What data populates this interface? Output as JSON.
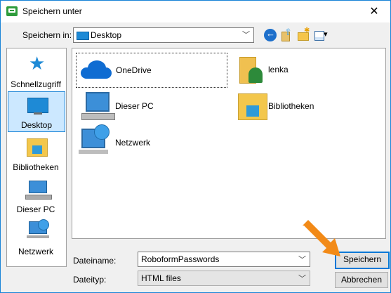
{
  "window": {
    "title": "Speichern unter",
    "close_glyph": "✕"
  },
  "toolbar": {
    "lookin_label": "Speichern in:",
    "lookin_value": "Desktop"
  },
  "places": [
    {
      "label": "Schnellzugriff",
      "icon": "star-icon",
      "selected": false
    },
    {
      "label": "Desktop",
      "icon": "desktop-icon",
      "selected": true
    },
    {
      "label": "Bibliotheken",
      "icon": "libraries-icon",
      "selected": false
    },
    {
      "label": "Dieser PC",
      "icon": "computer-icon",
      "selected": false
    },
    {
      "label": "Netzwerk",
      "icon": "network-icon",
      "selected": false
    }
  ],
  "items": [
    {
      "label": "OneDrive",
      "icon": "onedrive-icon"
    },
    {
      "label": "lenka",
      "icon": "user-folder-icon"
    },
    {
      "label": "Dieser PC",
      "icon": "computer-icon"
    },
    {
      "label": "Bibliotheken",
      "icon": "libraries-icon"
    },
    {
      "label": "Netzwerk",
      "icon": "network-icon"
    }
  ],
  "filename": {
    "label": "Dateiname:",
    "value": "RoboformPasswords"
  },
  "filetype": {
    "label": "Dateityp:",
    "value": "HTML files"
  },
  "buttons": {
    "save": "Speichern",
    "cancel": "Abbrechen"
  },
  "colors": {
    "accent": "#0078d7",
    "selected_bg": "#cce8ff",
    "arrow": "#f28a17"
  }
}
